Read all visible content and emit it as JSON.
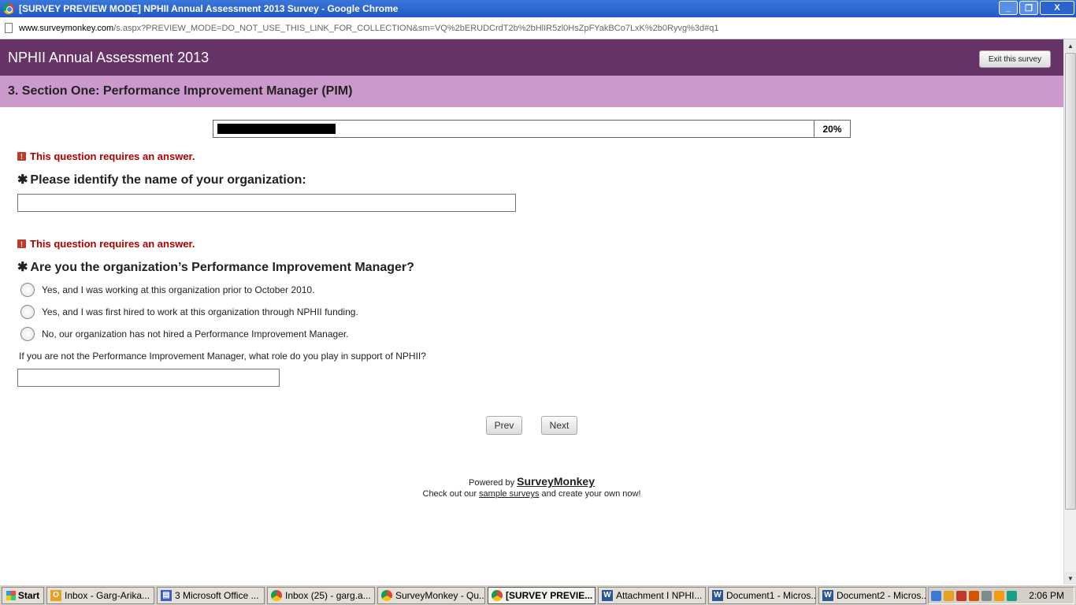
{
  "window": {
    "title": "[SURVEY PREVIEW MODE] NPHII Annual Assessment 2013 Survey - Google Chrome",
    "controls": [
      "_",
      "❐",
      "X"
    ]
  },
  "address": {
    "host": "www.surveymonkey.com",
    "path": "/s.aspx?PREVIEW_MODE=DO_NOT_USE_THIS_LINK_FOR_COLLECTION&sm=VQ%2bERUDCrdT2b%2bHlIR5zl0HsZpFYakBCo7LxK%2b0Ryvg%3d#q1"
  },
  "survey": {
    "title": "NPHII Annual Assessment 2013",
    "exit_label": "Exit this survey",
    "section_title": "3. Section One: Performance Improvement Manager (PIM)",
    "progress": {
      "percent": 20,
      "label": "20%"
    },
    "required_star": "✱",
    "error_icon": "!",
    "q1": {
      "error": "This question requires an answer.",
      "title": "Please identify the name of your organization:",
      "value": ""
    },
    "q2": {
      "error": "This question requires an answer.",
      "title": "Are you the organization’s Performance Improvement Manager?",
      "options": [
        "Yes, and I was working at this organization prior to October 2010.",
        "Yes, and I was first hired to work at this organization through NPHII funding.",
        "No, our organization has not hired a Performance Improvement Manager."
      ],
      "other_label": "If you are not the Performance Improvement Manager, what role do you play in support of NPHII?",
      "other_value": ""
    },
    "nav": {
      "prev": "Prev",
      "next": "Next"
    },
    "footer": {
      "powered_by": "Powered by",
      "brand": "SurveyMonkey",
      "check_out": "Check out our",
      "sample_link": "sample surveys",
      "create": "and create your own now!"
    }
  },
  "taskbar": {
    "start": "Start",
    "tasks": [
      {
        "label": "Inbox - Garg-Arika...",
        "icon": "outlook-icon",
        "color": "#e8a020",
        "glyph": "O"
      },
      {
        "label": "3 Microsoft Office ...",
        "icon": "office-icon",
        "color": "#3a5fcd",
        "glyph": "▤"
      },
      {
        "label": "Inbox (25) - garg.a...",
        "icon": "chrome-icon",
        "color": "#db4437",
        "glyph": ""
      },
      {
        "label": "SurveyMonkey - Qu...",
        "icon": "chrome-icon",
        "color": "#db4437",
        "glyph": ""
      },
      {
        "label": "[SURVEY PREVIE...",
        "icon": "chrome-icon",
        "color": "#db4437",
        "glyph": "",
        "active": true
      },
      {
        "label": "Attachment I  NPHI...",
        "icon": "word-icon",
        "color": "#2b5797",
        "glyph": "W"
      },
      {
        "label": "Document1 - Micros...",
        "icon": "word-icon",
        "color": "#2b5797",
        "glyph": "W"
      },
      {
        "label": "Document2 - Micros...",
        "icon": "word-icon",
        "color": "#2b5797",
        "glyph": "W"
      }
    ],
    "clock": "2:06 PM",
    "tray_colors": [
      "#3a7bd5",
      "#e8a020",
      "#c0392b",
      "#d35400",
      "#7f8c8d",
      "#f39c12",
      "#16a085"
    ]
  }
}
